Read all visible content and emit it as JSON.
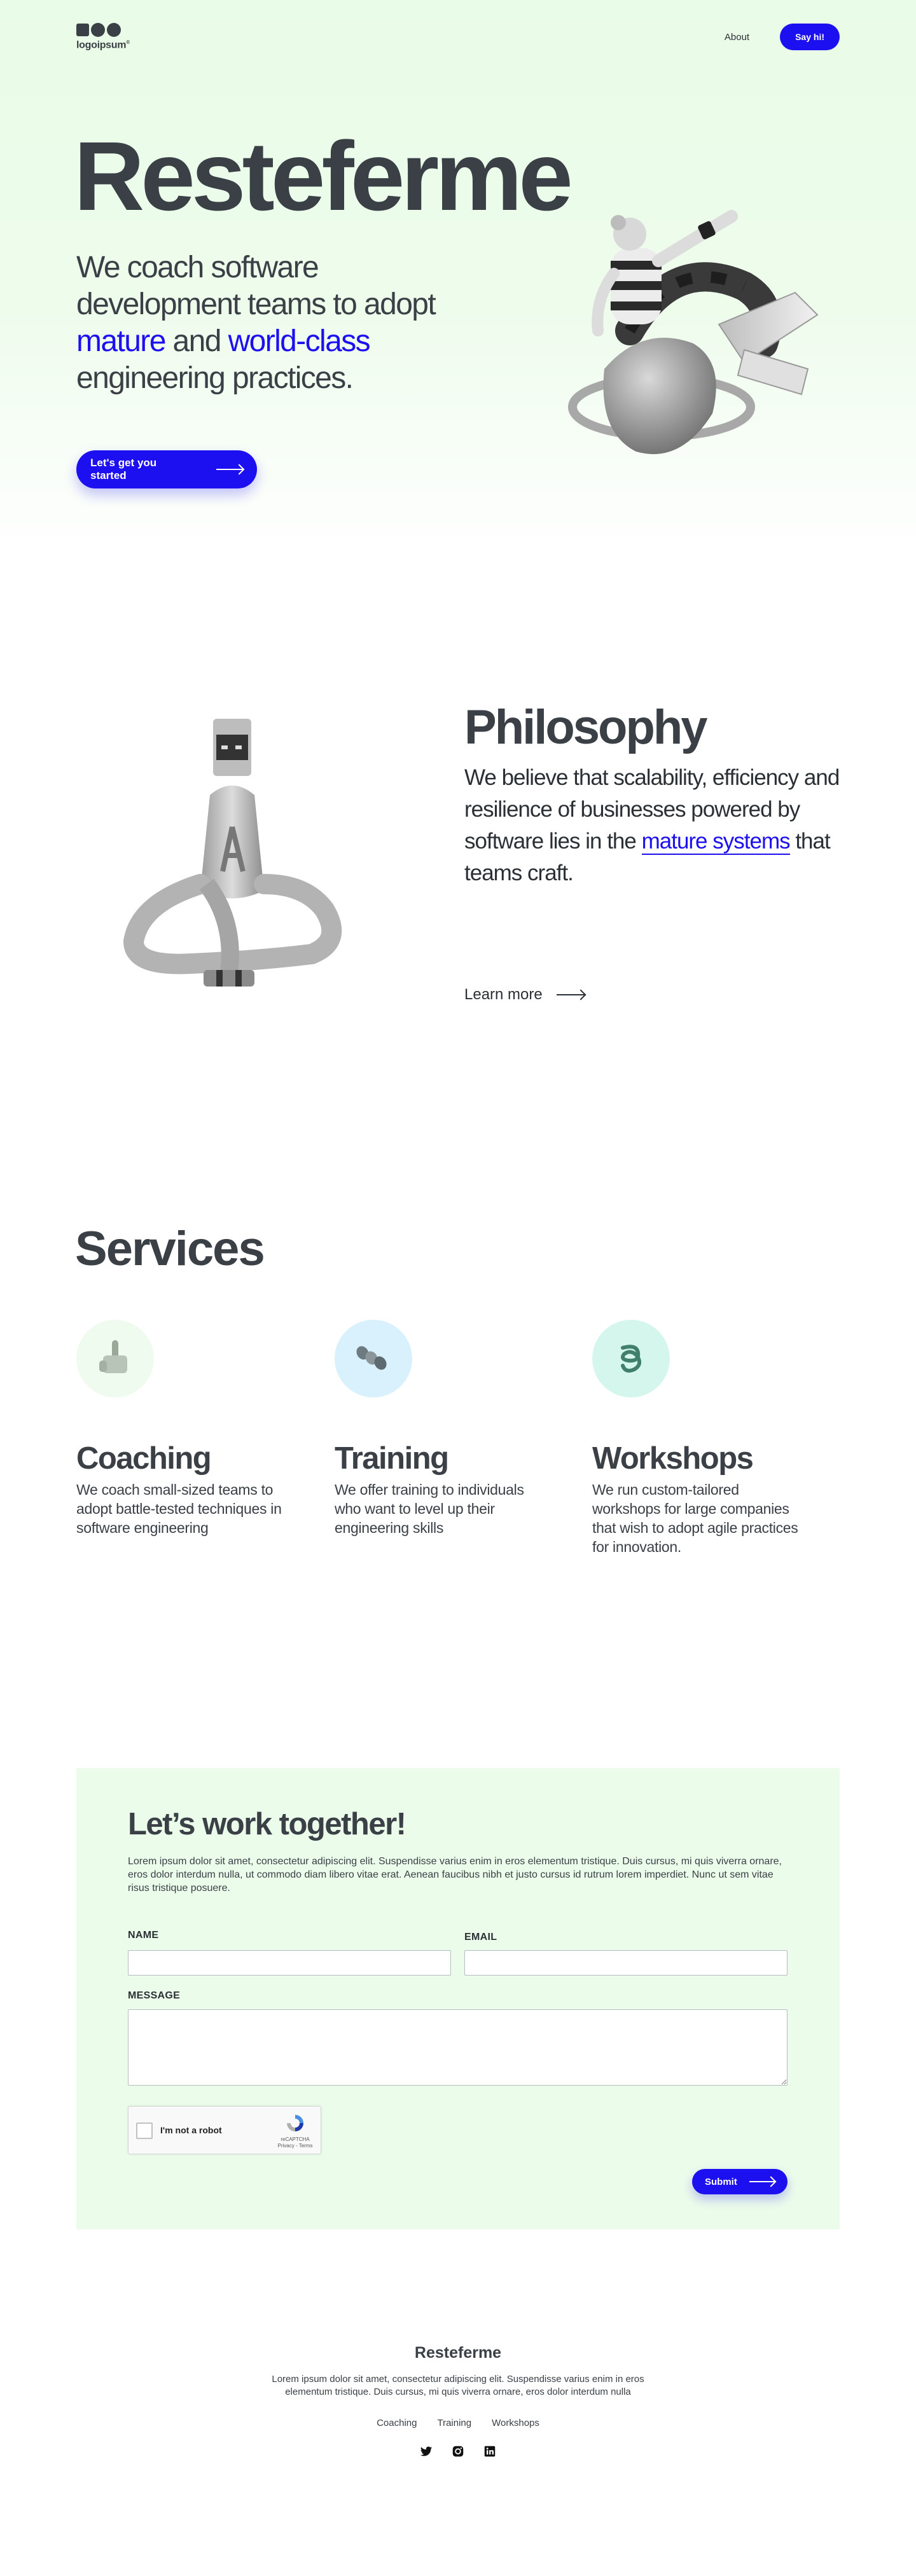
{
  "header": {
    "logo_text": "logoipsum",
    "logo_mark": "®",
    "nav_about": "About",
    "cta": "Say hi!"
  },
  "hero": {
    "title": "Resteferme",
    "subtitle_part1": "We coach software development teams to adopt ",
    "subtitle_highlight1": "mature",
    "subtitle_and": " and ",
    "subtitle_highlight2": "world-class",
    "subtitle_part2": " engineering practices.",
    "cta": "Let's get you started"
  },
  "philosophy": {
    "title": "Philosophy",
    "text_before": "We believe that scalability, efficiency and resilience of businesses powered by software lies in the ",
    "text_link": "mature systems",
    "text_after": " that teams craft.",
    "learn_more": "Learn more"
  },
  "services": {
    "title": "Services",
    "items": [
      {
        "name": "Coaching",
        "desc": "We coach small-sized teams to adopt battle-tested techniques in software engineering",
        "icon": "pointing-hand-icon",
        "bg": "#effbee"
      },
      {
        "name": "Training",
        "desc": "We offer training to individuals who want to level up their engineering skills",
        "icon": "cylinder-chain-icon",
        "bg": "#d9f1fc"
      },
      {
        "name": "Workshops",
        "desc": "We run custom-tailored workshops for large companies that wish to adopt agile practices for innovation.",
        "icon": "spiral-icon",
        "bg": "#d5f6ec"
      }
    ]
  },
  "contact": {
    "title": "Let’s work together!",
    "lead": "Lorem ipsum dolor sit amet, consectetur adipiscing elit. Suspendisse varius enim in eros elementum tristique. Duis cursus, mi quis viverra ornare, eros dolor interdum nulla, ut commodo diam libero vitae erat. Aenean faucibus nibh et justo cursus id rutrum lorem imperdiet. Nunc ut sem vitae risus tristique posuere.",
    "name_label": "NAME",
    "email_label": "EMAIL",
    "message_label": "MESSAGE",
    "name_value": "",
    "email_value": "",
    "message_value": "",
    "captcha_label": "I'm not a robot",
    "captcha_brand": "reCAPTCHA",
    "captcha_links": "Privacy - Terms",
    "submit": "Submit"
  },
  "footer": {
    "title": "Resteferme",
    "text": "Lorem ipsum dolor sit amet, consectetur adipiscing elit. Suspendisse varius enim in eros elementum tristique. Duis cursus, mi quis viverra ornare, eros dolor interdum nulla",
    "links": [
      "Coaching",
      "Training",
      "Workshops"
    ],
    "social": [
      "twitter-icon",
      "instagram-icon",
      "linkedin-icon"
    ]
  },
  "colors": {
    "accent": "#1d10f0",
    "text": "#3a4046",
    "hero_bg": "#e9fce7"
  }
}
